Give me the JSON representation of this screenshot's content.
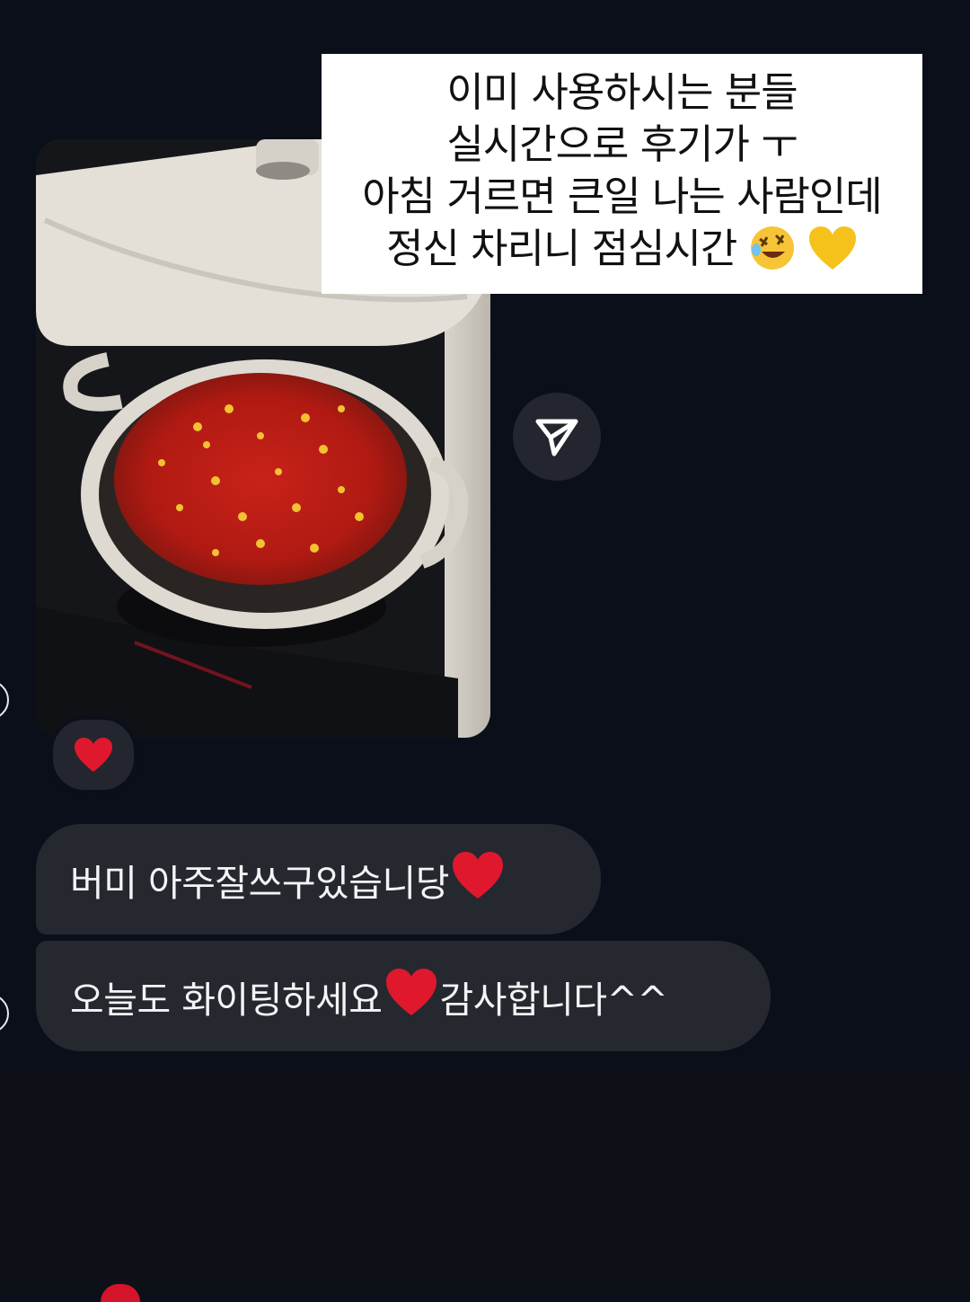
{
  "overlay_caption": {
    "lines": [
      "이미 사용하시는 분들",
      "실시간으로 후기가 ㅜ",
      "아침 거르면 큰일 나는 사람인데",
      "정신 차리니 점심시간"
    ],
    "emojis": [
      "rolling-on-floor-laughing-emoji",
      "yellow-heart-emoji"
    ]
  },
  "photo_message": {
    "icon": "photo-of-tomato-stew-in-pot",
    "reaction": "red-heart-emoji"
  },
  "share_button": {
    "icon": "paper-plane-icon"
  },
  "messages": [
    {
      "text": "버미 아주잘쓰구있습니당",
      "emoji": "red-heart-emoji"
    },
    {
      "text_before": "오늘도 화이팅하세요",
      "emoji": "red-heart-emoji",
      "text_after": "감사합니다^^"
    }
  ],
  "colors": {
    "background": "#0b0f1a",
    "bubble": "#26282f",
    "heart": "#e0182d",
    "caption_background": "#ffffff"
  }
}
